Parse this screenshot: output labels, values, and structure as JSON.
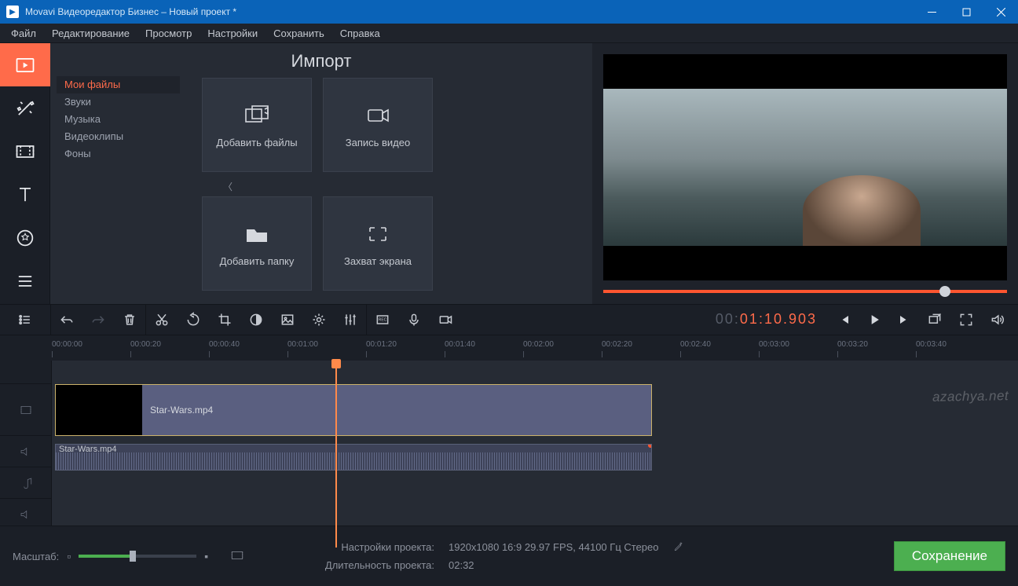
{
  "window": {
    "title": "Movavi Видеоредактор Бизнес – Новый проект *"
  },
  "menu": [
    "Файл",
    "Редактирование",
    "Просмотр",
    "Настройки",
    "Сохранить",
    "Справка"
  ],
  "import": {
    "title": "Импорт",
    "categories": [
      "Мои файлы",
      "Звуки",
      "Музыка",
      "Видеоклипы",
      "Фоны"
    ],
    "cards": {
      "add_files": "Добавить файлы",
      "record_video": "Запись видео",
      "add_folder": "Добавить папку",
      "screen_capture": "Захват экрана"
    }
  },
  "timecode": {
    "prefix": "00:",
    "main": "01:10.903"
  },
  "timeline_ticks": [
    "00:00:00",
    "00:00:20",
    "00:00:40",
    "00:01:00",
    "00:01:20",
    "00:01:40",
    "00:02:00",
    "00:02:20",
    "00:02:40",
    "00:03:00",
    "00:03:20",
    "00:03:40"
  ],
  "clip": {
    "video": "Star-Wars.mp4",
    "audio": "Star-Wars.mp4"
  },
  "footer": {
    "zoom_label": "Масштаб:",
    "project_settings_label": "Настройки проекта:",
    "project_settings_value": "1920x1080 16:9 29.97 FPS, 44100 Гц Стерео",
    "duration_label": "Длительность проекта:",
    "duration_value": "02:32",
    "save": "Сохранение"
  },
  "watermark": "azachya.net"
}
